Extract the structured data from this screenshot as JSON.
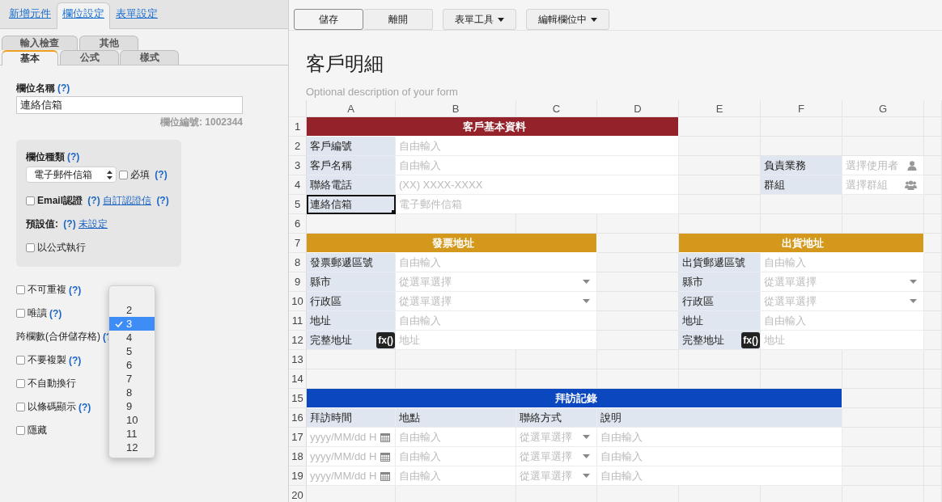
{
  "left_panel": {
    "top_tabs": [
      {
        "label": "新增元件",
        "selected": false
      },
      {
        "label": "欄位設定",
        "selected": true
      },
      {
        "label": "表單設定",
        "selected": false
      }
    ],
    "sub_tabs_back": [
      {
        "label": "輸入檢查",
        "selected": false
      },
      {
        "label": "其他",
        "selected": false
      }
    ],
    "sub_tabs_front": [
      {
        "label": "基本",
        "selected": true
      },
      {
        "label": "公式",
        "selected": false
      },
      {
        "label": "樣式",
        "selected": false
      }
    ],
    "field_name": {
      "label": "欄位名稱",
      "help": "(?)",
      "value": "連絡信箱",
      "field_id": "欄位編號: 1002344"
    },
    "type_box": {
      "label": "欄位種類",
      "help": "(?)",
      "select_value": "電子郵件信箱",
      "required": {
        "label": "必填",
        "help": "(?)",
        "checked": false
      },
      "email_verify": {
        "label": "Email認證",
        "help": "(?)",
        "link": "自訂認證信",
        "link_help": "(?)",
        "checked": false
      },
      "default_value": {
        "label": "預設值:",
        "help": "(?)",
        "link": "未設定"
      },
      "formula": {
        "label": "以公式執行",
        "checked": false
      }
    },
    "options": [
      {
        "kind": "checkbox",
        "label": "不可重複",
        "help": "(?)",
        "checked": false
      },
      {
        "kind": "checkbox",
        "label": "唯讀",
        "help": "(?)",
        "checked": false
      },
      {
        "kind": "text",
        "label": "跨欄數(合併儲存格)",
        "help": "(?"
      },
      {
        "kind": "checkbox",
        "label": "不要複製",
        "help": "(?)",
        "checked": false
      },
      {
        "kind": "checkbox",
        "label": "不自動換行",
        "checked": false
      },
      {
        "kind": "checkbox",
        "label": "以條碼顯示",
        "help": "(?)",
        "checked": false
      },
      {
        "kind": "checkbox",
        "label": "隱藏",
        "checked": false
      }
    ],
    "span_dropdown": [
      {
        "label": "2",
        "selected": false
      },
      {
        "label": "3",
        "selected": true
      },
      {
        "label": "4",
        "selected": false
      },
      {
        "label": "5",
        "selected": false
      },
      {
        "label": "6",
        "selected": false
      },
      {
        "label": "7",
        "selected": false
      },
      {
        "label": "8",
        "selected": false
      },
      {
        "label": "9",
        "selected": false
      },
      {
        "label": "10",
        "selected": false
      },
      {
        "label": "11",
        "selected": false
      },
      {
        "label": "12",
        "selected": false
      }
    ]
  },
  "toolbar": [
    {
      "buttons": [
        {
          "label": "儲存",
          "kind": "button",
          "focused": true
        },
        {
          "label": "離開",
          "kind": "button",
          "focused": false
        }
      ]
    },
    {
      "buttons": [
        {
          "label": "表單工具",
          "kind": "menu",
          "focused": false
        }
      ]
    },
    {
      "buttons": [
        {
          "label": "編輯欄位中",
          "kind": "menu",
          "focused": false
        }
      ]
    }
  ],
  "form": {
    "title": "客戶明細",
    "description": "Optional description of your form"
  },
  "sheet": {
    "columns": [
      "A",
      "B",
      "C",
      "D",
      "E",
      "F",
      "G"
    ],
    "rows": [
      {
        "number": "1",
        "cells": [
          {
            "kind": "section",
            "text": "客戶基本資料",
            "color": "#93222a",
            "selected": false
          },
          {
            "kind": "merged"
          },
          {
            "kind": "merged"
          },
          {
            "kind": "merged"
          }
        ]
      },
      {
        "number": "2",
        "cells": [
          {
            "kind": "label",
            "text": "客戶編號",
            "selected": false
          },
          {
            "kind": "input",
            "text": "自由輸入",
            "selected": false
          },
          {
            "kind": "merged"
          },
          {
            "kind": "merged"
          }
        ]
      },
      {
        "number": "3",
        "cells": [
          {
            "kind": "label",
            "text": "客戶名稱",
            "selected": false
          },
          {
            "kind": "input",
            "text": "自由輸入",
            "selected": false
          },
          {
            "kind": "merged"
          },
          {
            "kind": "merged"
          },
          {
            "kind": "empty"
          },
          {
            "kind": "label",
            "text": "負責業務",
            "selected": false
          },
          {
            "kind": "user",
            "text": "選擇使用者",
            "selected": false
          }
        ]
      },
      {
        "number": "4",
        "cells": [
          {
            "kind": "label",
            "text": "聯絡電話",
            "selected": false
          },
          {
            "kind": "input",
            "text": "(XX) XXXX-XXXX",
            "selected": false
          },
          {
            "kind": "merged"
          },
          {
            "kind": "merged"
          },
          {
            "kind": "empty"
          },
          {
            "kind": "label",
            "text": "群組",
            "selected": false
          },
          {
            "kind": "group",
            "text": "選擇群組",
            "selected": false
          }
        ]
      },
      {
        "number": "5",
        "cells": [
          {
            "kind": "label",
            "text": "連絡信箱",
            "selected": true
          },
          {
            "kind": "input",
            "text": "電子郵件信箱",
            "selected": false
          },
          {
            "kind": "merged"
          },
          {
            "kind": "merged"
          }
        ]
      },
      {
        "number": "6"
      },
      {
        "number": "7",
        "cells": [
          {
            "kind": "section",
            "text": "發票地址",
            "color": "#d4991c",
            "selected": false
          },
          {
            "kind": "merged"
          },
          {
            "kind": "merged"
          },
          {
            "kind": "empty"
          },
          {
            "kind": "section",
            "text": "出貨地址",
            "color": "#d4991c",
            "selected": false
          },
          {
            "kind": "merged"
          },
          {
            "kind": "merged"
          }
        ]
      },
      {
        "number": "8",
        "cells": [
          {
            "kind": "label",
            "text": "發票郵遞區號",
            "selected": false
          },
          {
            "kind": "input",
            "text": "自由輸入",
            "selected": false
          },
          {
            "kind": "merged"
          },
          {
            "kind": "empty"
          },
          {
            "kind": "label",
            "text": "出貨郵遞區號",
            "selected": false
          },
          {
            "kind": "input",
            "text": "自由輸入",
            "selected": false
          },
          {
            "kind": "merged"
          }
        ]
      },
      {
        "number": "9",
        "cells": [
          {
            "kind": "label",
            "text": "縣市",
            "selected": false
          },
          {
            "kind": "select",
            "text": "從選單選擇",
            "selected": false
          },
          {
            "kind": "merged"
          },
          {
            "kind": "empty"
          },
          {
            "kind": "label",
            "text": "縣市",
            "selected": false
          },
          {
            "kind": "select",
            "text": "從選單選擇",
            "selected": false
          },
          {
            "kind": "merged"
          }
        ]
      },
      {
        "number": "10",
        "cells": [
          {
            "kind": "label",
            "text": "行政區",
            "selected": false
          },
          {
            "kind": "select",
            "text": "從選單選擇",
            "selected": false
          },
          {
            "kind": "merged"
          },
          {
            "kind": "empty"
          },
          {
            "kind": "label",
            "text": "行政區",
            "selected": false
          },
          {
            "kind": "select",
            "text": "從選單選擇",
            "selected": false
          },
          {
            "kind": "merged"
          }
        ]
      },
      {
        "number": "11",
        "cells": [
          {
            "kind": "label",
            "text": "地址",
            "selected": false
          },
          {
            "kind": "input",
            "text": "自由輸入",
            "selected": false
          },
          {
            "kind": "merged"
          },
          {
            "kind": "empty"
          },
          {
            "kind": "label",
            "text": "地址",
            "selected": false
          },
          {
            "kind": "input",
            "text": "自由輸入",
            "selected": false
          },
          {
            "kind": "merged"
          }
        ]
      },
      {
        "number": "12",
        "cells": [
          {
            "kind": "formula",
            "text": "完整地址",
            "badge": "fx()",
            "selected": false
          },
          {
            "kind": "input",
            "text": "地址",
            "selected": false
          },
          {
            "kind": "merged"
          },
          {
            "kind": "empty"
          },
          {
            "kind": "formula",
            "text": "完整地址",
            "badge": "fx()",
            "selected": false
          },
          {
            "kind": "input",
            "text": "地址",
            "selected": false
          },
          {
            "kind": "merged"
          }
        ]
      },
      {
        "number": "13"
      },
      {
        "number": "14"
      },
      {
        "number": "15",
        "cells": [
          {
            "kind": "section",
            "text": "拜訪記錄",
            "color": "#0b48bf",
            "selected": false
          },
          {
            "kind": "merged"
          },
          {
            "kind": "merged"
          },
          {
            "kind": "merged"
          },
          {
            "kind": "merged"
          },
          {
            "kind": "merged"
          }
        ]
      },
      {
        "number": "16",
        "cells": [
          {
            "kind": "header",
            "text": "拜訪時間",
            "selected": false
          },
          {
            "kind": "header",
            "text": "地點",
            "selected": false
          },
          {
            "kind": "header",
            "text": "聯絡方式",
            "selected": false
          },
          {
            "kind": "header",
            "text": "說明",
            "selected": false
          },
          {
            "kind": "merged"
          },
          {
            "kind": "merged"
          }
        ]
      },
      {
        "number": "17",
        "cells": [
          {
            "kind": "datetime",
            "text": "yyyy/MM/dd H",
            "selected": false
          },
          {
            "kind": "input",
            "text": "自由輸入",
            "selected": false
          },
          {
            "kind": "select",
            "text": "從選單選擇",
            "selected": false
          },
          {
            "kind": "input",
            "text": "自由輸入",
            "selected": false
          },
          {
            "kind": "merged"
          },
          {
            "kind": "merged"
          }
        ]
      },
      {
        "number": "18",
        "cells": [
          {
            "kind": "datetime",
            "text": "yyyy/MM/dd H",
            "selected": false
          },
          {
            "kind": "input",
            "text": "自由輸入",
            "selected": false
          },
          {
            "kind": "select",
            "text": "從選單選擇",
            "selected": false
          },
          {
            "kind": "input",
            "text": "自由輸入",
            "selected": false
          },
          {
            "kind": "merged"
          },
          {
            "kind": "merged"
          }
        ]
      },
      {
        "number": "19",
        "cells": [
          {
            "kind": "datetime",
            "text": "yyyy/MM/dd H",
            "selected": false
          },
          {
            "kind": "input",
            "text": "自由輸入",
            "selected": false
          },
          {
            "kind": "select",
            "text": "從選單選擇",
            "selected": false
          },
          {
            "kind": "input",
            "text": "自由輸入",
            "selected": false
          },
          {
            "kind": "merged"
          },
          {
            "kind": "merged"
          }
        ]
      },
      {
        "number": "20"
      }
    ]
  }
}
